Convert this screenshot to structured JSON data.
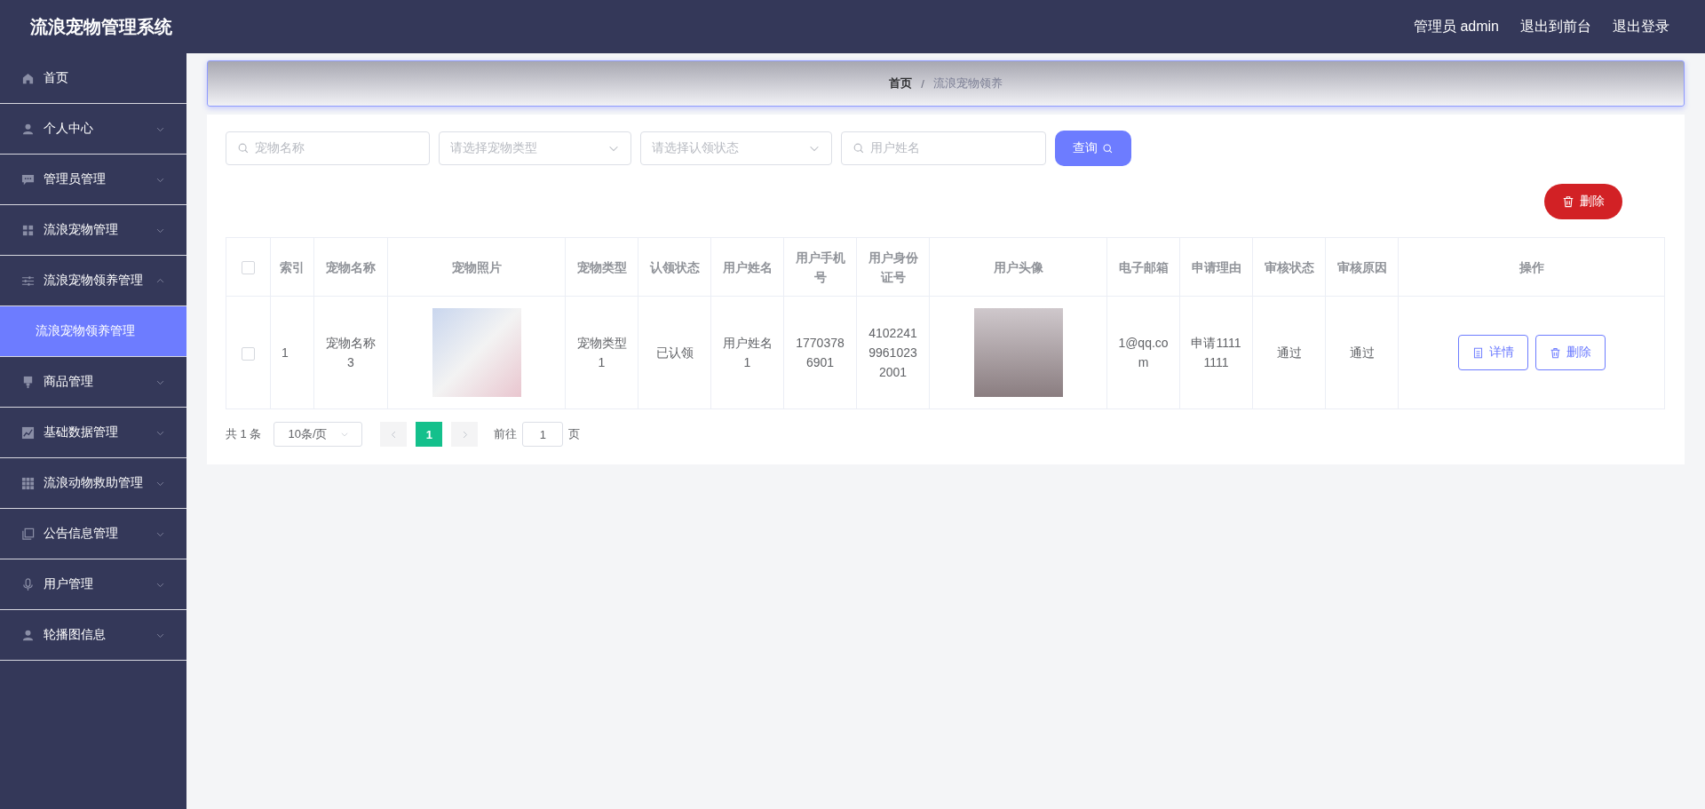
{
  "app_title": "流浪宠物管理系统",
  "header_links": [
    "管理员 admin",
    "退出到前台",
    "退出登录"
  ],
  "sidebar": {
    "items": [
      {
        "label": "首页",
        "kind": "link"
      },
      {
        "label": "个人中心",
        "kind": "menu",
        "expanded": false
      },
      {
        "label": "管理员管理",
        "kind": "menu",
        "expanded": false
      },
      {
        "label": "流浪宠物管理",
        "kind": "menu",
        "expanded": false
      },
      {
        "label": "流浪宠物领养管理",
        "kind": "menu",
        "expanded": true,
        "children": [
          {
            "label": "流浪宠物领养管理",
            "selected": true
          }
        ]
      },
      {
        "label": "商品管理",
        "kind": "menu",
        "expanded": false
      },
      {
        "label": "基础数据管理",
        "kind": "menu",
        "expanded": false
      },
      {
        "label": "流浪动物救助管理",
        "kind": "menu",
        "expanded": false
      },
      {
        "label": "公告信息管理",
        "kind": "menu",
        "expanded": false
      },
      {
        "label": "用户管理",
        "kind": "menu",
        "expanded": false
      },
      {
        "label": "轮播图信息",
        "kind": "menu",
        "expanded": false
      }
    ]
  },
  "breadcrumb": [
    "首页",
    "流浪宠物领养"
  ],
  "breadcrumb_separator": "/",
  "filters": [
    {
      "kind": "search",
      "placeholder": "宠物名称"
    },
    {
      "kind": "select",
      "placeholder": "请选择宠物类型"
    },
    {
      "kind": "select",
      "placeholder": "请选择认领状态"
    },
    {
      "kind": "search",
      "placeholder": "用户姓名"
    }
  ],
  "query_button": "查询",
  "delete_button": "删除",
  "table": {
    "select_all_checked": false,
    "columns": [
      "索引",
      "宠物名称",
      "宠物照片",
      "宠物类型",
      "认领状态",
      "用户姓名",
      "用户手机号",
      "用户身份证号",
      "用户头像",
      "电子邮箱",
      "申请理由",
      "审核状态",
      "审核原因",
      "操作"
    ],
    "rows": [
      {
        "checked": false,
        "cells": [
          "1",
          "宠物名称3",
          null,
          "宠物类型1",
          "已认领",
          "用户姓名1",
          "17703786901",
          "410224199610232001",
          null,
          "1@qq.com",
          "申请11111111",
          "通过",
          "通过"
        ],
        "actions": [
          "详情",
          "删除"
        ]
      }
    ]
  },
  "pagination": {
    "total": "共 1 条",
    "page_size": "10条/页",
    "prev_disabled": true,
    "next_disabled": true,
    "pages": [
      {
        "label": "1",
        "selected": true
      }
    ],
    "goto_label": "前往",
    "goto_value": "1",
    "goto_suffix": "页"
  }
}
